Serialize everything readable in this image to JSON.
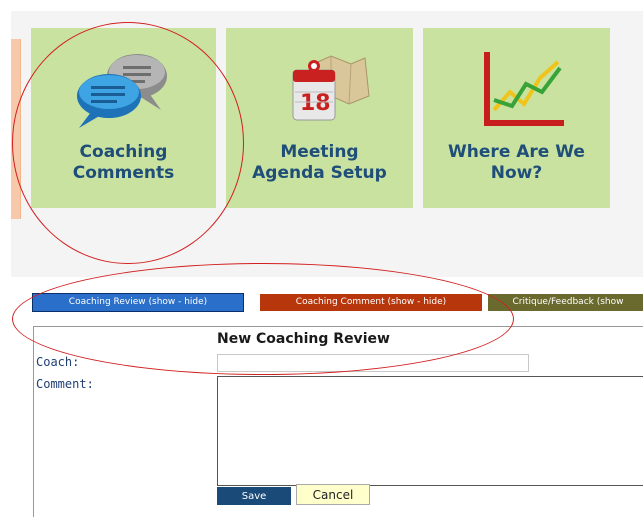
{
  "tiles": [
    {
      "label_line1": "Coaching",
      "label_line2": "Comments",
      "icon": "chat-bubbles-icon"
    },
    {
      "label_line1": "Meeting",
      "label_line2": "Agenda Setup",
      "icon": "calendar-map-icon"
    },
    {
      "label_line1": "Where Are We",
      "label_line2": "Now?",
      "icon": "line-chart-icon"
    }
  ],
  "tabs": [
    {
      "label": "Coaching Review (show - hide)",
      "color": "#2a6fc9"
    },
    {
      "label": "Coaching Comment (show - hide)",
      "color": "#b8360c"
    },
    {
      "label": "Critique/Feedback (show",
      "color": "#6a6a2e"
    }
  ],
  "form": {
    "title": "New Coaching Review",
    "coach_label": "Coach:",
    "comment_label": "Comment:",
    "coach_value": "",
    "comment_value": "",
    "save_label": "Save",
    "cancel_label": "Cancel"
  },
  "colors": {
    "tile_bg": "#c9e2a0",
    "tile_text": "#1f4e79",
    "annotation": "#d21f1f",
    "save_bg": "#1a4a78",
    "cancel_bg": "#ffffcc"
  }
}
